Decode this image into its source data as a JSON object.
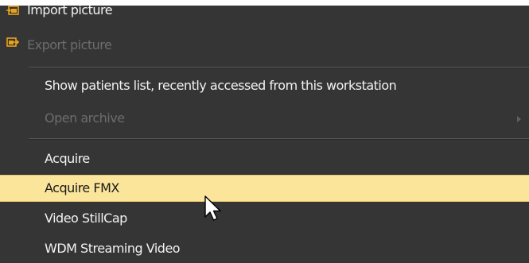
{
  "menu": {
    "items": [
      {
        "label": "Import picture",
        "icon": "import-picture-icon",
        "enabled": true
      },
      {
        "label": "Export picture",
        "icon": "export-picture-icon",
        "enabled": false
      },
      {
        "label": "Show patients list, recently accessed from this workstation",
        "enabled": true
      },
      {
        "label": "Open archive",
        "enabled": false,
        "has_submenu": true
      },
      {
        "label": "Acquire",
        "enabled": true
      },
      {
        "label": "Acquire FMX",
        "enabled": true,
        "highlighted": true
      },
      {
        "label": "Video StillCap",
        "enabled": true
      },
      {
        "label": "WDM Streaming Video",
        "enabled": true
      }
    ]
  },
  "colors": {
    "menu_background": "#353535",
    "highlight": "#fbe59a",
    "icon_accent": "#e8a21a",
    "disabled_text": "#6c6c6c"
  }
}
